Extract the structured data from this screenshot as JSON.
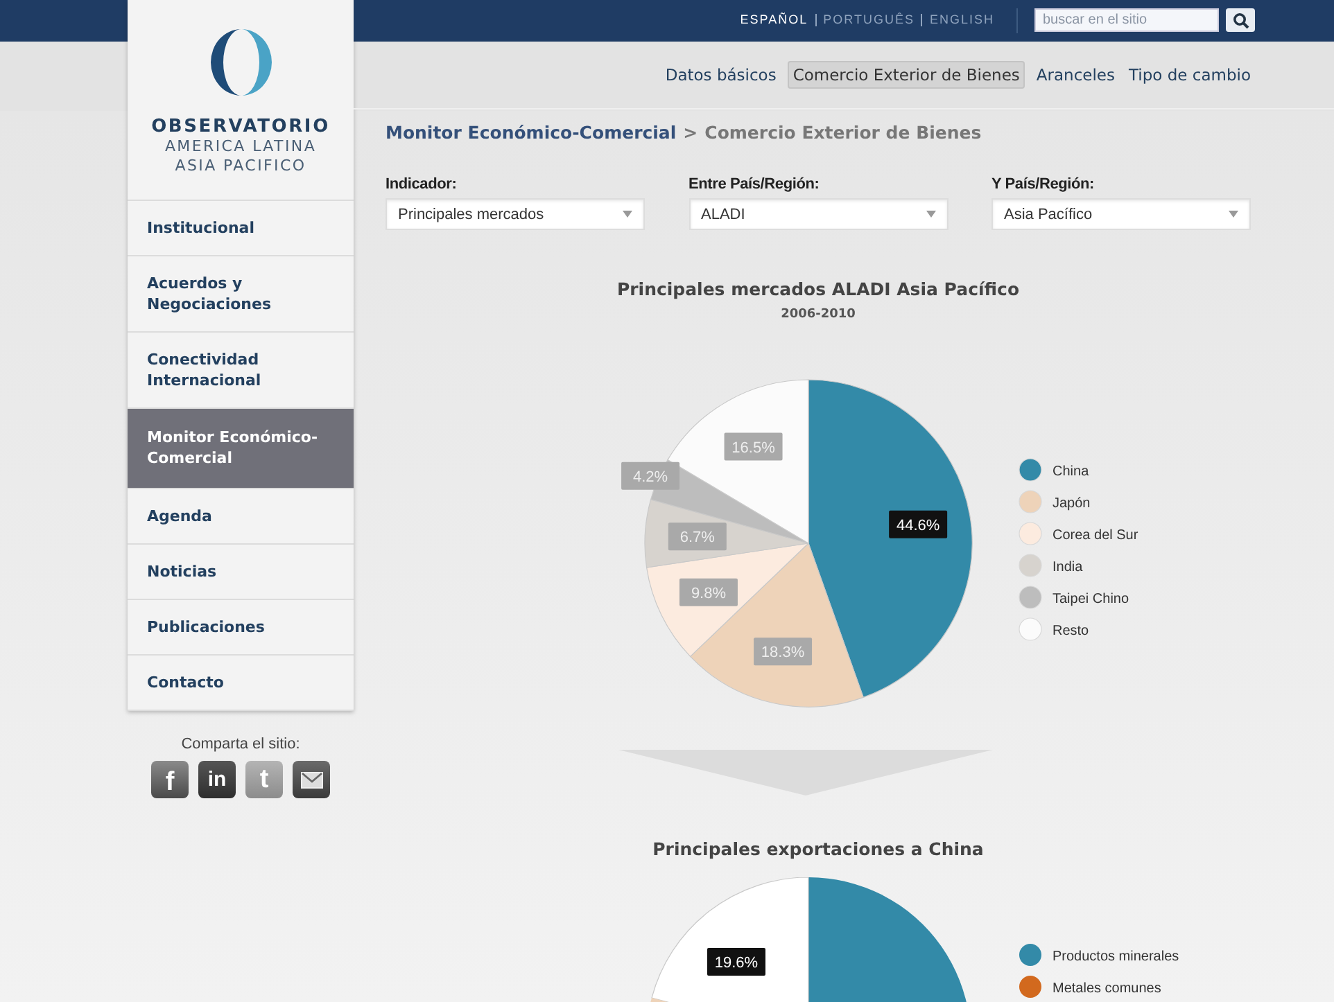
{
  "top_bar": {
    "languages": [
      {
        "label": "ESPAÑOL",
        "selected": true
      },
      {
        "label": "PORTUGUÊS",
        "selected": false
      },
      {
        "label": "ENGLISH",
        "selected": false
      }
    ],
    "search": {
      "placeholder": "buscar en el sitio"
    }
  },
  "logo": {
    "name": "OBSERVATORIO",
    "lines": [
      "AMERICA LATINA",
      "ASIA PACIFICO"
    ]
  },
  "sidebar": {
    "items": [
      {
        "label": "Institucional",
        "selected": false
      },
      {
        "label": "Acuerdos y Negociaciones",
        "selected": false
      },
      {
        "label": "Conectividad Internacional",
        "selected": false
      },
      {
        "label": "Monitor Económico-Comercial",
        "selected": true
      },
      {
        "label": "Agenda",
        "selected": false
      },
      {
        "label": "Noticias",
        "selected": false
      },
      {
        "label": "Publicaciones",
        "selected": false
      },
      {
        "label": "Contacto",
        "selected": false
      }
    ]
  },
  "share": {
    "label": "Comparta el sitio:",
    "icons": [
      {
        "kind": "glyph",
        "glyph": "f"
      },
      {
        "kind": "glyph",
        "glyph": "in"
      },
      {
        "kind": "glyph",
        "glyph": "t"
      },
      {
        "kind": "mail"
      }
    ]
  },
  "subnav": {
    "tabs": [
      {
        "label": "Datos básicos",
        "selected": false
      },
      {
        "label": "Comercio Exterior de Bienes",
        "selected": true
      },
      {
        "label": "Aranceles",
        "selected": false
      },
      {
        "label": "Tipo de cambio",
        "selected": false
      }
    ]
  },
  "breadcrumb": {
    "link": "Monitor Económico-Comercial",
    "separator": ">",
    "current": "Comercio Exterior de Bienes"
  },
  "filters": [
    {
      "label": "Indicador:",
      "value": "Principales mercados"
    },
    {
      "label": "Entre País/Región:",
      "value": "ALADI"
    },
    {
      "label": "Y País/Región:",
      "value": "Asia Pacífico"
    }
  ],
  "main_chart": {
    "chart_data": {
      "type": "pie",
      "title": "Principales mercados ALADI Asia Pacífico",
      "subtitle": "2006-2010",
      "categories": [
        "China",
        "Japón",
        "Corea del Sur",
        "India",
        "Taipei Chino",
        "Resto"
      ],
      "values": [
        44.6,
        18.3,
        9.8,
        6.7,
        4.2,
        16.5
      ],
      "legend": true,
      "colors": [
        "#338aa8",
        "#eed3b9",
        "#fcebdf",
        "#d7d3ce",
        "#bdbdbd",
        "#fbfbfb"
      ],
      "value_labels": [
        {
          "label": "44.6%",
          "selected": true
        },
        {
          "label": "18.3%",
          "selected": false
        },
        {
          "label": "9.8%",
          "selected": false
        },
        {
          "label": "6.7%",
          "selected": false
        },
        {
          "label": "4.2%",
          "selected": false
        },
        {
          "label": "16.5%",
          "selected": false
        }
      ]
    }
  },
  "second_chart": {
    "title": "Principales exportaciones a China",
    "value_label": {
      "label": "19.6%",
      "selected": true
    },
    "legend": [
      {
        "label": "Productos minerales",
        "color": "#338aa8"
      },
      {
        "label": "Metales comunes",
        "color": "#d2691e"
      }
    ]
  }
}
